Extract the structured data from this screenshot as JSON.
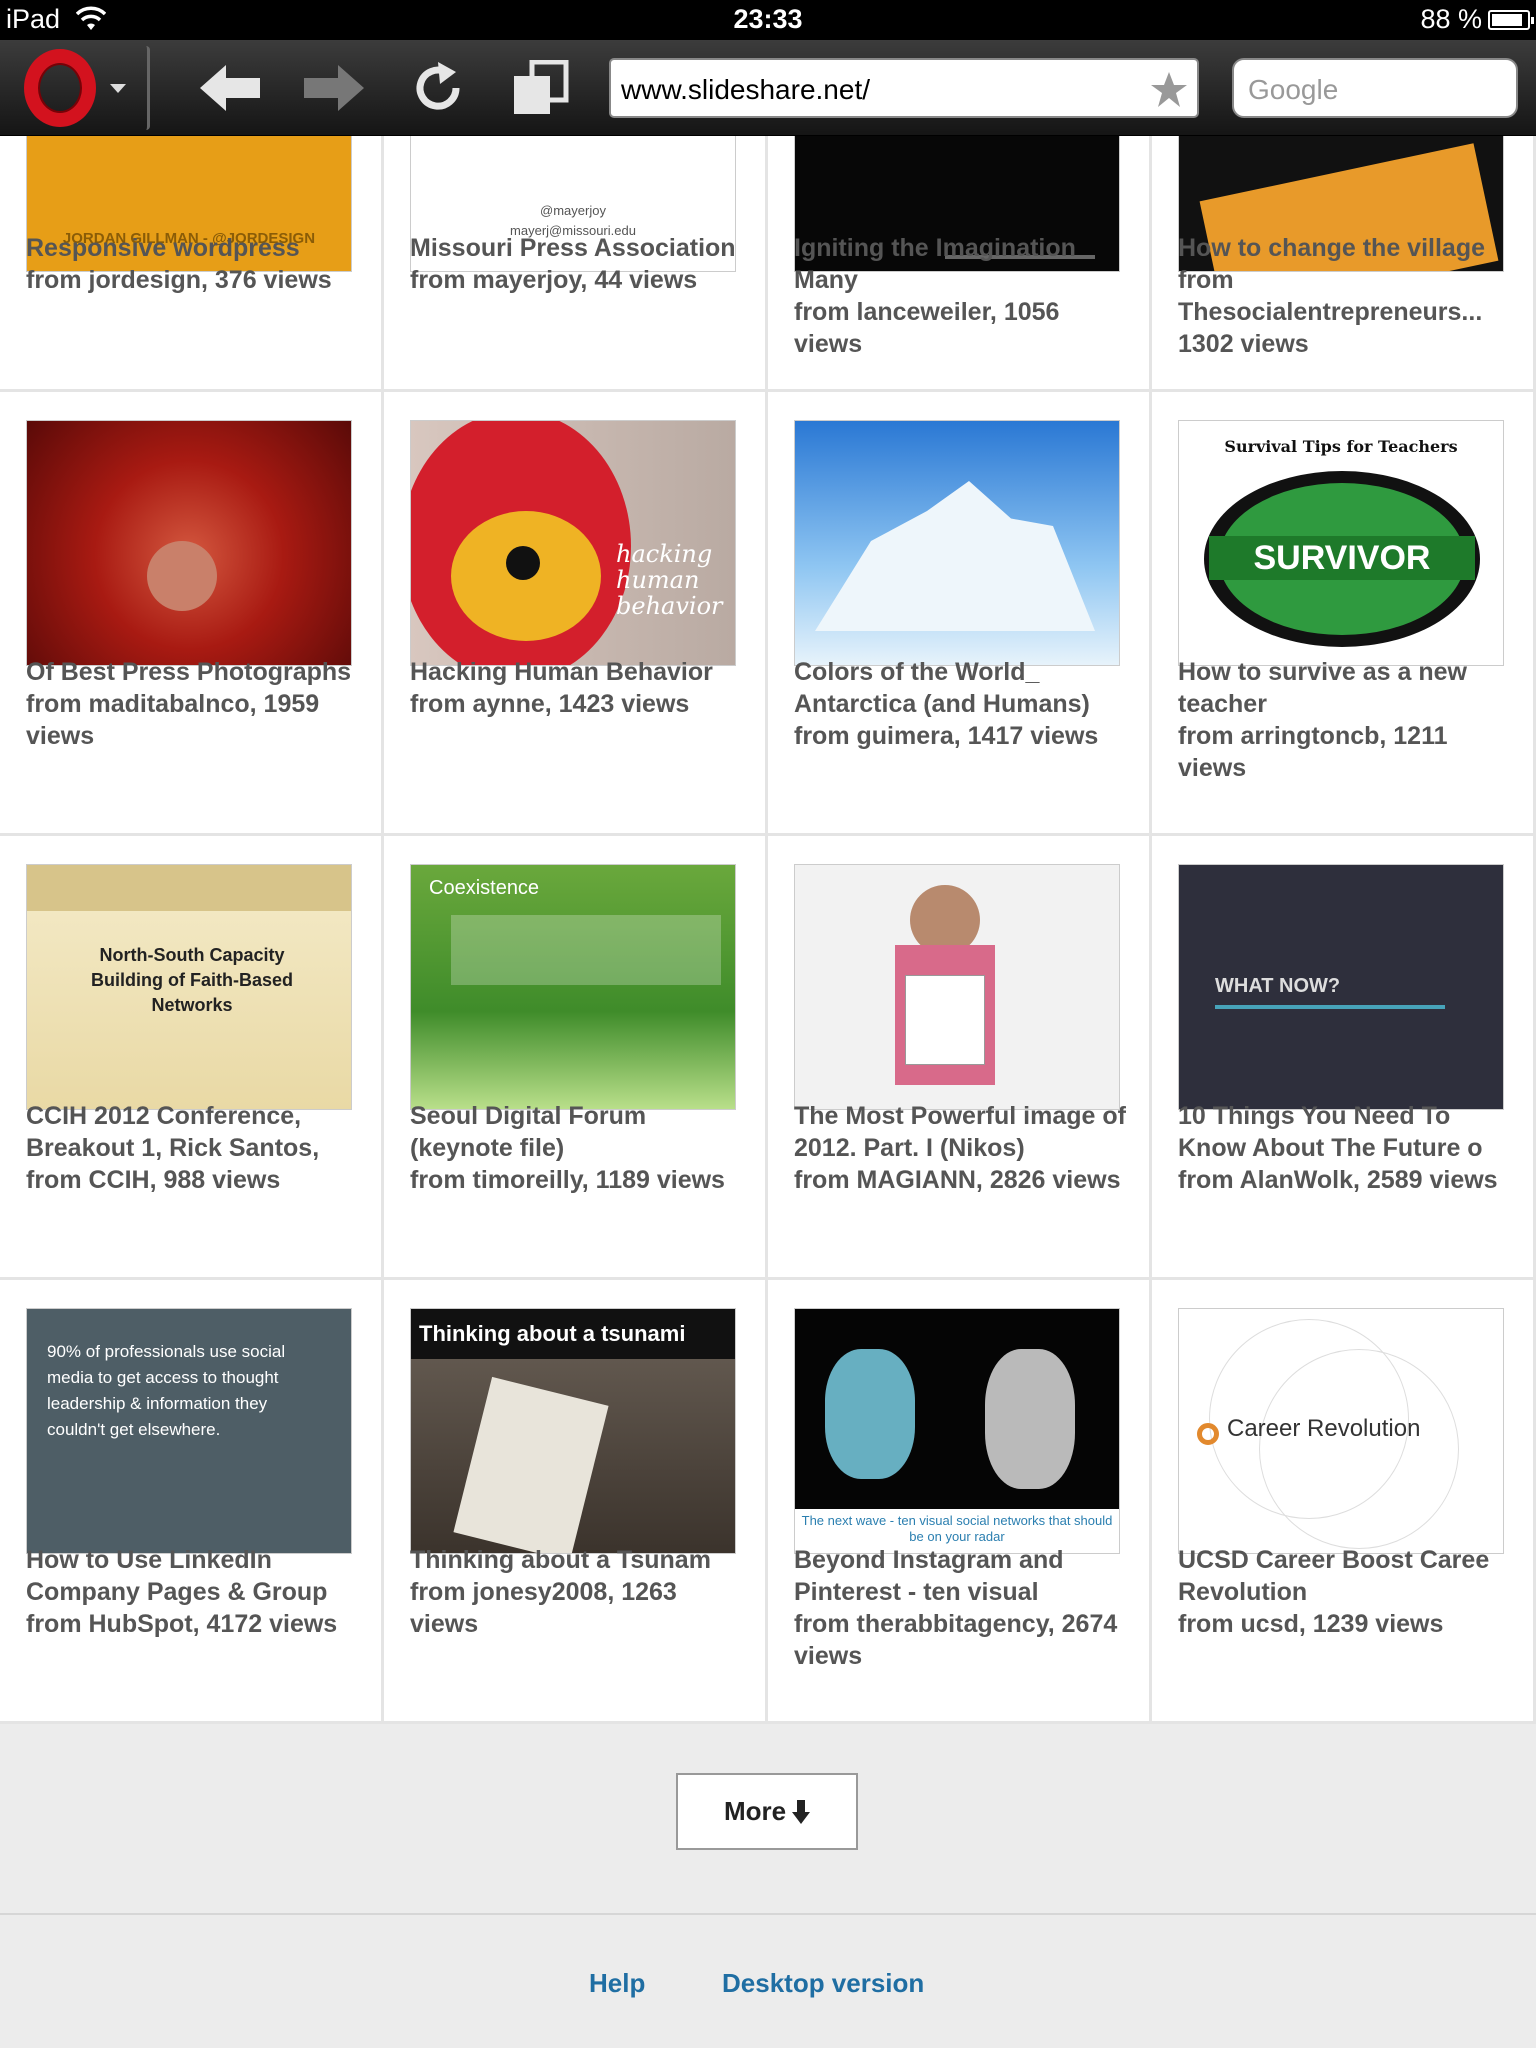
{
  "status_bar": {
    "device": "iPad",
    "time": "23:33",
    "battery": "88 %",
    "battery_level": 0.88
  },
  "browser": {
    "url": "www.slideshare.net/",
    "search_placeholder": "Google",
    "opera_icon": "opera-logo-icon",
    "brand_color": "#d3121e"
  },
  "grid": {
    "rows": [
      [
        {
          "title": "Responsive wordpress",
          "meta": "from jordesign, 376 views",
          "thumb_text": "JORDAN GILLMAN - @JORDESIGN"
        },
        {
          "title": "Missouri Press Association",
          "meta": "from mayerjoy, 44 views",
          "thumb_text": "@mayerjoy\nmayerj@missouri.edu"
        },
        {
          "title": "Igniting the Imagination Many",
          "meta": "from lanceweiler, 1056 views",
          "thumb_text": ""
        },
        {
          "title": "How to change the village",
          "meta": "from Thesocialentrepreneurs... 1302 views",
          "thumb_text": ""
        }
      ],
      [
        {
          "title": "Of Best Press Photographs",
          "meta": "from maditabalnco, 1959 views",
          "thumb_text": ""
        },
        {
          "title": "Hacking Human Behavior",
          "meta": "from aynne, 1423 views",
          "thumb_text": "hacking human behavior"
        },
        {
          "title": "Colors of the World_ Antarctica (and Humans)",
          "meta": "from guimera, 1417 views",
          "thumb_text": ""
        },
        {
          "title": "How to survive as a new teacher",
          "meta": "from arringtoncb, 1211 views",
          "thumb_text": "Survival Tips for Teachers"
        }
      ],
      [
        {
          "title": "CCIH 2012 Conference, Breakout 1, Rick Santos,",
          "meta": "from CCIH, 988 views",
          "thumb_text": "North-South Capacity Building of Faith-Based Networks"
        },
        {
          "title": "Seoul Digital Forum (keynote file)",
          "meta": "from timoreilly, 1189 views",
          "thumb_text": "Coexistence"
        },
        {
          "title": "The Most Powerful image of 2012. Part. I (Nikos)",
          "meta": "from MAGIANN, 2826 views",
          "thumb_text": ""
        },
        {
          "title": "10 Things You Need To Know About The Future o",
          "meta": "from AlanWolk, 2589 views",
          "thumb_text": "WHAT NOW?"
        }
      ],
      [
        {
          "title": "How to Use LinkedIn Company Pages & Group",
          "meta": "from HubSpot, 4172 views",
          "thumb_text": "90% of professionals use social media to get access to thought leadership & information they couldn't get elsewhere."
        },
        {
          "title": "Thinking about a Tsunam",
          "meta": "from jonesy2008, 1263 views",
          "thumb_text": "Thinking about a tsunami"
        },
        {
          "title": "Beyond Instagram and Pinterest - ten visual",
          "meta": "from therabbitagency, 2674 views",
          "thumb_text": "The next wave - ten visual social networks that should be on your radar"
        },
        {
          "title": "UCSD Career Boost Caree Revolution",
          "meta": "from ucsd, 1239 views",
          "thumb_text": "Career Revolution"
        }
      ]
    ]
  },
  "more_button": "More",
  "footer": {
    "help": "Help",
    "desktop": "Desktop version",
    "link_color": "#1f6ea3"
  }
}
